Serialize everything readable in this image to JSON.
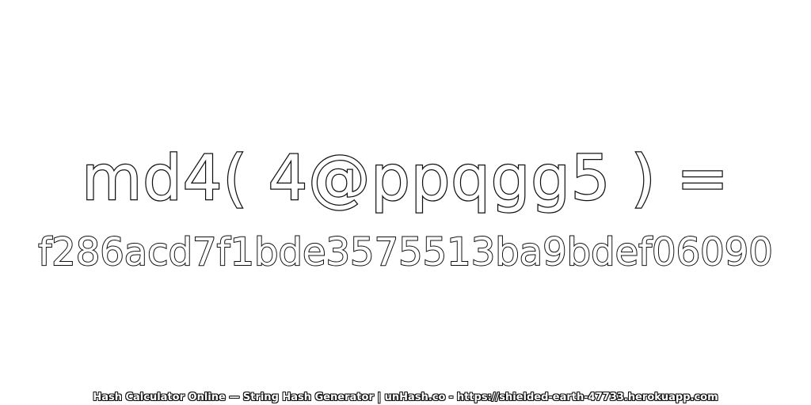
{
  "headline": "md4( 4@ppqgg5 ) =",
  "hash_value": "f286acd7f1bde3575513ba9bdef06090",
  "footer": "Hash Calculator Online — String Hash Generator | unHash.co - https://shielded-earth-47733.herokuapp.com",
  "colors": {
    "background": "#ffffff",
    "text_fill": "#ffffff",
    "text_outline": "#111111"
  }
}
